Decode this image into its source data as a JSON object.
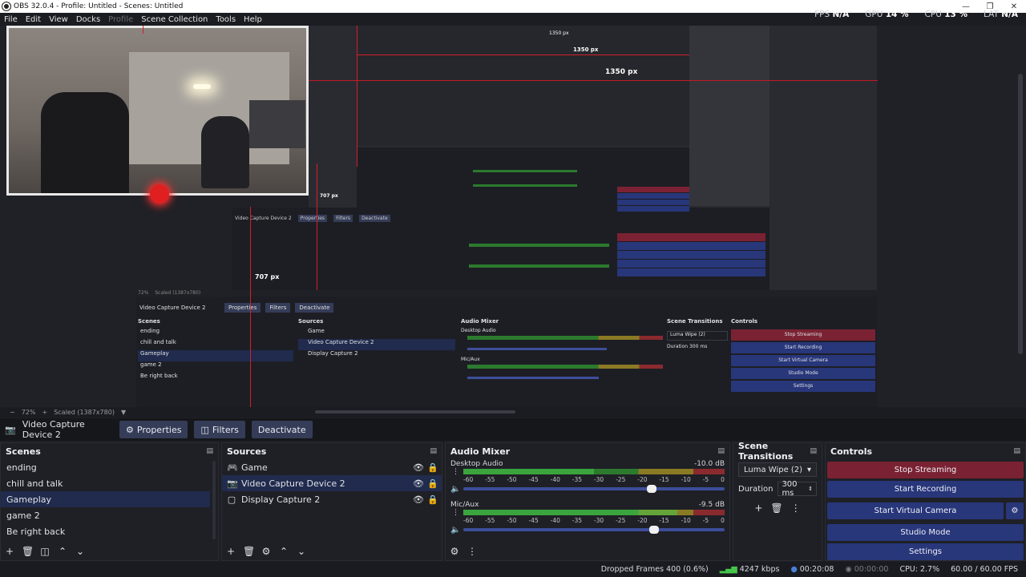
{
  "window": {
    "title": "OBS 32.0.4 - Profile: Untitled - Scenes: Untitled"
  },
  "menu": [
    "File",
    "Edit",
    "View",
    "Docks",
    "Profile",
    "Scene Collection",
    "Tools",
    "Help"
  ],
  "stats": {
    "fps_label": "FPS",
    "fps": "N/A",
    "gpu_label": "GPU",
    "gpu": "14 %",
    "cpu_label": "CPU",
    "cpu": "13 %",
    "lat_label": "LAT",
    "lat": "N/A"
  },
  "preview": {
    "annotations": [
      "1350 px",
      "1350 px",
      "1350 px",
      "707 px",
      "707 px"
    ],
    "nested": {
      "source_name": "Video Capture Device 2",
      "properties": "Properties",
      "filters": "Filters",
      "deactivate": "Deactivate",
      "scenes_title": "Scenes",
      "sources_title": "Sources",
      "mixer_title": "Audio Mixer",
      "transitions_title": "Scene Transitions",
      "controls_title": "Controls",
      "zoom": "72%",
      "scaled": "Scaled (1387x780)"
    }
  },
  "zoombar": {
    "zoom": "72%",
    "scaled": "Scaled (1387x780)"
  },
  "source_toolbar": {
    "source_name": "Video Capture Device 2",
    "properties": "Properties",
    "filters": "Filters",
    "deactivate": "Deactivate"
  },
  "scenes": {
    "title": "Scenes",
    "items": [
      "ending",
      "chill and talk",
      "Gameplay",
      "game 2",
      "Be right back"
    ],
    "selected": 2
  },
  "sources": {
    "title": "Sources",
    "items": [
      {
        "name": "Game",
        "icon": "game-capture-icon"
      },
      {
        "name": "Video Capture Device 2",
        "icon": "camera-icon"
      },
      {
        "name": "Display Capture 2",
        "icon": "monitor-icon"
      }
    ],
    "selected": 1
  },
  "mixer": {
    "title": "Audio Mixer",
    "channels": [
      {
        "name": "Desktop Audio",
        "db": "-10.0 dB",
        "level": 0.5,
        "volume": 0.72
      },
      {
        "name": "Mic/Aux",
        "db": "-9.5 dB",
        "level": 0.82,
        "volume": 0.73
      }
    ],
    "ticks": [
      "-60",
      "-55",
      "-50",
      "-45",
      "-40",
      "-35",
      "-30",
      "-25",
      "-20",
      "-15",
      "-10",
      "-5",
      "0"
    ]
  },
  "transitions": {
    "title": "Scene Transitions",
    "selected": "Luma Wipe (2)",
    "duration_label": "Duration",
    "duration": "300 ms"
  },
  "controls": {
    "title": "Controls",
    "stop_streaming": "Stop Streaming",
    "start_recording": "Start Recording",
    "start_virtual_camera": "Start Virtual Camera",
    "studio_mode": "Studio Mode",
    "settings": "Settings"
  },
  "status": {
    "dropped": "Dropped Frames 400 (0.6%)",
    "bitrate": "4247 kbps",
    "stream_time": "00:20:08",
    "rec_time": "00:00:00",
    "cpu": "CPU: 2.7%",
    "fps": "60.00 / 60.00 FPS"
  },
  "colors": {
    "accent": "#28367a",
    "stop": "#7a2233",
    "selected_row": "#202b4d",
    "record": "#e02020"
  }
}
